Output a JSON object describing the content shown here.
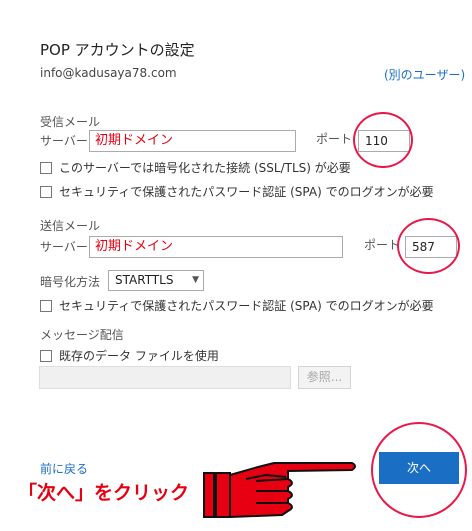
{
  "dialog": {
    "title": "POP アカウントの設定",
    "account": "info@kadusaya78.com",
    "other_user_link": "(別のユーザー)"
  },
  "incoming": {
    "section_label": "受信メール",
    "server_label": "サーバー",
    "server_value": "初期ドメイン",
    "port_label": "ポート",
    "port_value": "110",
    "ssl_checkbox": "このサーバーでは暗号化された接続 (SSL/TLS) が必要",
    "ssl_checked": false,
    "spa_checkbox": "セキュリティで保護されたパスワード認証 (SPA) でのログオンが必要",
    "spa_checked": false
  },
  "outgoing": {
    "section_label": "送信メール",
    "server_label": "サーバー",
    "server_value": "初期ドメイン",
    "port_label": "ポート",
    "port_value": "587",
    "encryption_label": "暗号化方法",
    "encryption_value": "STARTTLS",
    "spa_checkbox": "セキュリティで保護されたパスワード認証 (SPA) でのログオンが必要",
    "spa_checked": false
  },
  "delivery": {
    "section_label": "メッセージ配信",
    "existing_file_checkbox": "既存のデータ ファイルを使用",
    "existing_file_checked": false,
    "file_path_value": "",
    "browse_button": "参照..."
  },
  "footer": {
    "back_link": "前に戻る",
    "next_button": "次へ"
  },
  "annotation": {
    "callout_text": "「次へ」をクリック",
    "highlight_color": "#e8194a",
    "text_color": "#e60012"
  },
  "colors": {
    "accent": "#1a6fc4",
    "link": "#1a6fc4"
  }
}
